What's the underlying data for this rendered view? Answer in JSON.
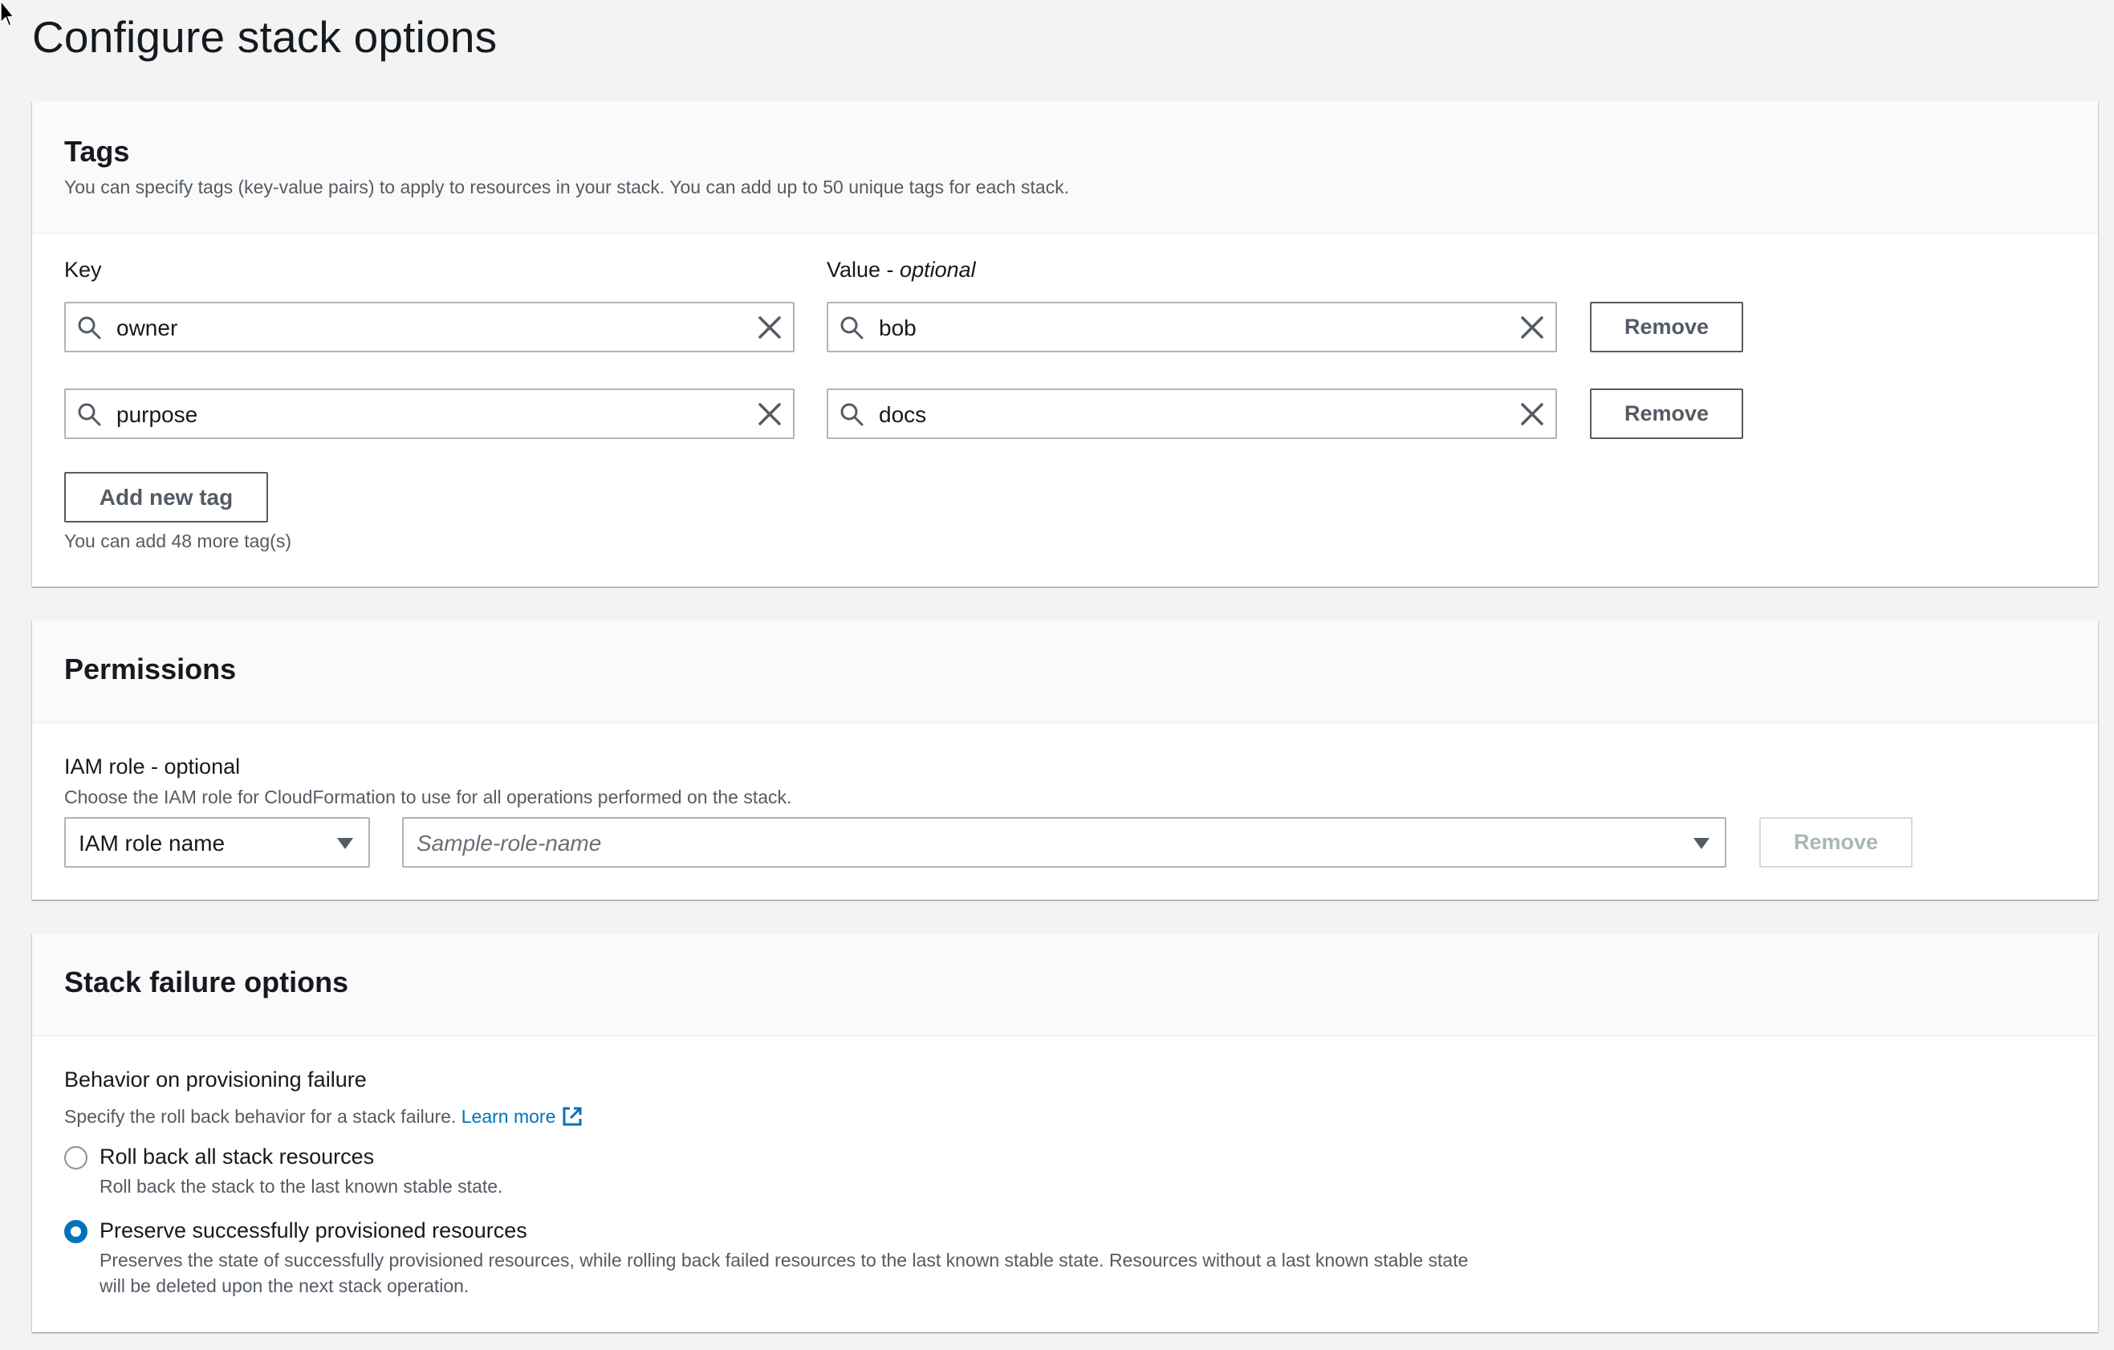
{
  "page": {
    "title": "Configure stack options"
  },
  "tags": {
    "title": "Tags",
    "description": "You can specify tags (key-value pairs) to apply to resources in your stack. You can add up to 50 unique tags for each stack.",
    "key_label": "Key",
    "value_label": "Value - ",
    "value_label_optional": "optional",
    "rows": [
      {
        "key": "owner",
        "value": "bob",
        "remove_label": "Remove"
      },
      {
        "key": "purpose",
        "value": "docs",
        "remove_label": "Remove"
      }
    ],
    "add_button_label": "Add new tag",
    "remaining_hint": "You can add 48 more tag(s)"
  },
  "permissions": {
    "title": "Permissions",
    "iam_label": "IAM role - optional",
    "iam_description": "Choose the IAM role for CloudFormation to use for all operations performed on the stack.",
    "role_type_selected": "IAM role name",
    "role_name_placeholder": "Sample-role-name",
    "remove_label": "Remove"
  },
  "stack_failure": {
    "title": "Stack failure options",
    "behavior_label": "Behavior on provisioning failure",
    "behavior_description": "Specify the roll back behavior for a stack failure.",
    "learn_more": "Learn more",
    "options": [
      {
        "label": "Roll back all stack resources",
        "description": "Roll back the stack to the last known stable state.",
        "selected": false
      },
      {
        "label": "Preserve successfully provisioned resources",
        "description_line1": "Preserves the state of successfully provisioned resources, while rolling back failed resources to the last known stable state. Resources without a last known stable state",
        "description_line2": "will be deleted upon the next stack operation.",
        "selected": true
      }
    ]
  },
  "icons": {
    "search": "search-icon",
    "clear": "close-icon",
    "caret": "caret-down-icon",
    "external": "external-link-icon",
    "cursor": "mouse-pointer-icon"
  },
  "colors": {
    "link": "#0073bb",
    "radio_selected": "#0073bb",
    "background": "#f2f3f3"
  }
}
